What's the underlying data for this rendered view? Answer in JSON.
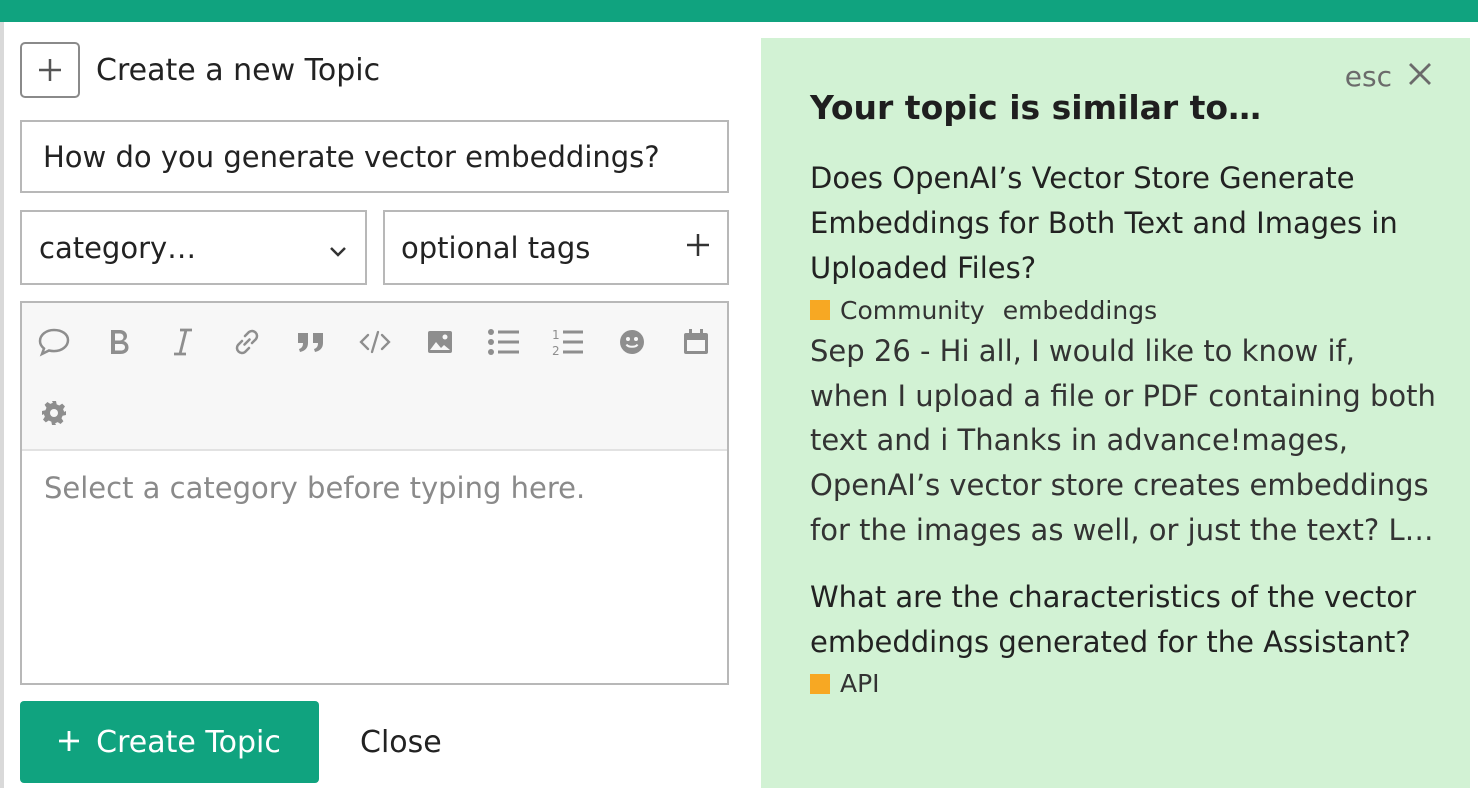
{
  "composer": {
    "header_title": "Create a new Topic",
    "title_value": "How do you generate vector embeddings?",
    "category_placeholder": "category…",
    "tags_placeholder": "optional tags",
    "editor_placeholder": "Select a category before typing here.",
    "create_button_label": "Create Topic",
    "close_button_label": "Close",
    "toolbar_icons": [
      "speech-bubble-icon",
      "bold-icon",
      "italic-icon",
      "link-icon",
      "quote-icon",
      "code-icon",
      "image-icon",
      "bullet-list-icon",
      "numbered-list-icon",
      "emoji-icon",
      "calendar-icon",
      "gear-icon"
    ]
  },
  "similar": {
    "esc_label": "esc",
    "title": "Your topic is similar to…",
    "topics": [
      {
        "title": "Does OpenAI’s Vector Store Generate Embeddings for Both Text and Images in Uploaded Files?",
        "category": "Community",
        "tags": [
          "embeddings"
        ],
        "excerpt": "Sep 26 - Hi all, I would like to know if, when I upload a file or PDF containing both text and i Thanks in advance!mages, OpenAI’s vector store creates embeddings for the images as well, or just the text? L…"
      },
      {
        "title": "What are the characteristics of the vector embeddings generated for the Assistant?",
        "category": "API",
        "tags": [],
        "excerpt": ""
      }
    ]
  },
  "colors": {
    "brand": "#10a37f",
    "similar_panel_bg": "#d2f2d4",
    "category_square": "#f7a823"
  }
}
